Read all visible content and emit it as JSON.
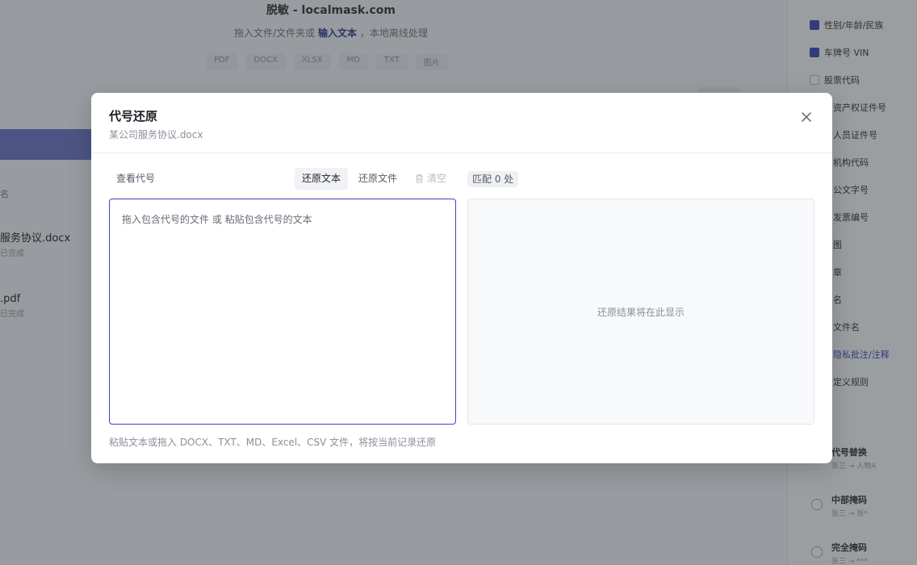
{
  "background": {
    "title": "脱敏 - localmask.com",
    "subtitle_prefix": "拖入文件/文件夹或",
    "subtitle_link": "输入文本",
    "subtitle_suffix": "，本地离线处理",
    "formats": [
      "PDF",
      "DOCX",
      "XLSX",
      "MD",
      "TXT",
      "图片"
    ],
    "column_header": "名",
    "files": [
      {
        "name": "服务协议.docx",
        "status": "已完成"
      },
      {
        "name": ".pdf",
        "status": "已完成"
      }
    ],
    "sidebar": {
      "checked_items": [
        "性别/年龄/民族",
        "车牌号 VIN"
      ],
      "unchecked_items": [
        "股票代码"
      ],
      "labels": [
        "资产权证件号",
        "人员证件号",
        "机构代码",
        "公文字号",
        "发票编号",
        "图",
        "章",
        "名",
        "文件名",
        "隐私批注/注释",
        "定义规则"
      ],
      "cards": [
        {
          "title": "代号替换",
          "sub": "张三 → 人物A"
        },
        {
          "title": "中部掩码",
          "sub": "张三 → 张*"
        },
        {
          "title": "完全掩码",
          "sub": "张三 → ***"
        }
      ]
    }
  },
  "modal": {
    "title": "代号还原",
    "subtitle": "某公司服务协议.docx",
    "close_icon": "close-icon",
    "toolbar": {
      "view_codes": "查看代号",
      "restore_text": "还原文本",
      "restore_file": "还原文件",
      "clear": "清空",
      "match": "匹配 0 处"
    },
    "input": {
      "value": "",
      "placeholder": "拖入包含代号的文件 或 粘贴包含代号的文本"
    },
    "output": {
      "placeholder": "还原结果将在此显示"
    },
    "hint": "粘贴文本或拖入 DOCX、TXT、MD、Excel、CSV 文件，将按当前记录还原"
  }
}
